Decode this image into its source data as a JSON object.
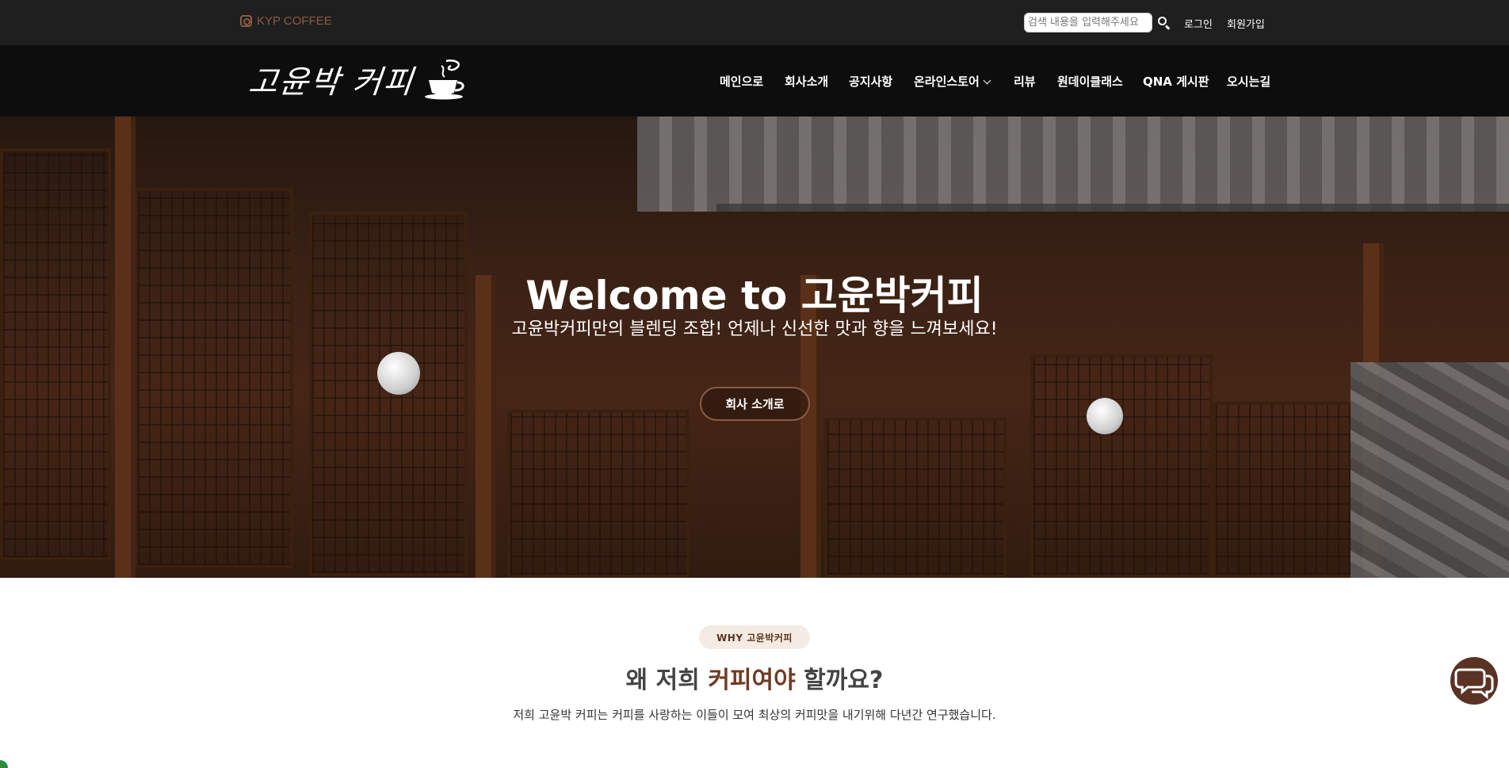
{
  "topbar": {
    "brand_label": "KYP COFFEE",
    "search_placeholder": "검색 내용을 입력해주세요",
    "login": "로그인",
    "signup": "회원가입"
  },
  "header": {
    "logo_text": "고윤박 커피",
    "nav": [
      {
        "label": "메인으로"
      },
      {
        "label": "회사소개"
      },
      {
        "label": "공지사항"
      },
      {
        "label": "온라인스토어",
        "has_dropdown": true
      },
      {
        "label": "리뷰"
      },
      {
        "label": "원데이클래스"
      },
      {
        "label": "QNA 게시판"
      },
      {
        "label": "오시는길"
      }
    ]
  },
  "hero": {
    "title": "Welcome to 고윤박커피",
    "subtitle": "고윤박커피만의 블렌딩 조합! 언제나 신선한 맛과 향을 느껴보세요!",
    "button": "회사 소개로"
  },
  "why": {
    "badge": "WHY 고윤박커피",
    "title_part1": "왜 저희 ",
    "title_accent": "커피여야",
    "title_part2": " 할까요?",
    "description": "저희 고윤박 커피는 커피를 사랑하는 이들이 모여 최상의 커피맛을 내기위해 다년간 연구했습니다."
  },
  "colors": {
    "accent": "#6e3b24",
    "topbar_bg": "#1f1f1f",
    "header_bg": "#0d0d0d",
    "chat_bg": "#5a3325"
  },
  "icons": {
    "brand": "instagram-icon",
    "search": "search-icon",
    "chat": "chat-bubbles-icon",
    "logo": "coffee-cup-icon"
  }
}
